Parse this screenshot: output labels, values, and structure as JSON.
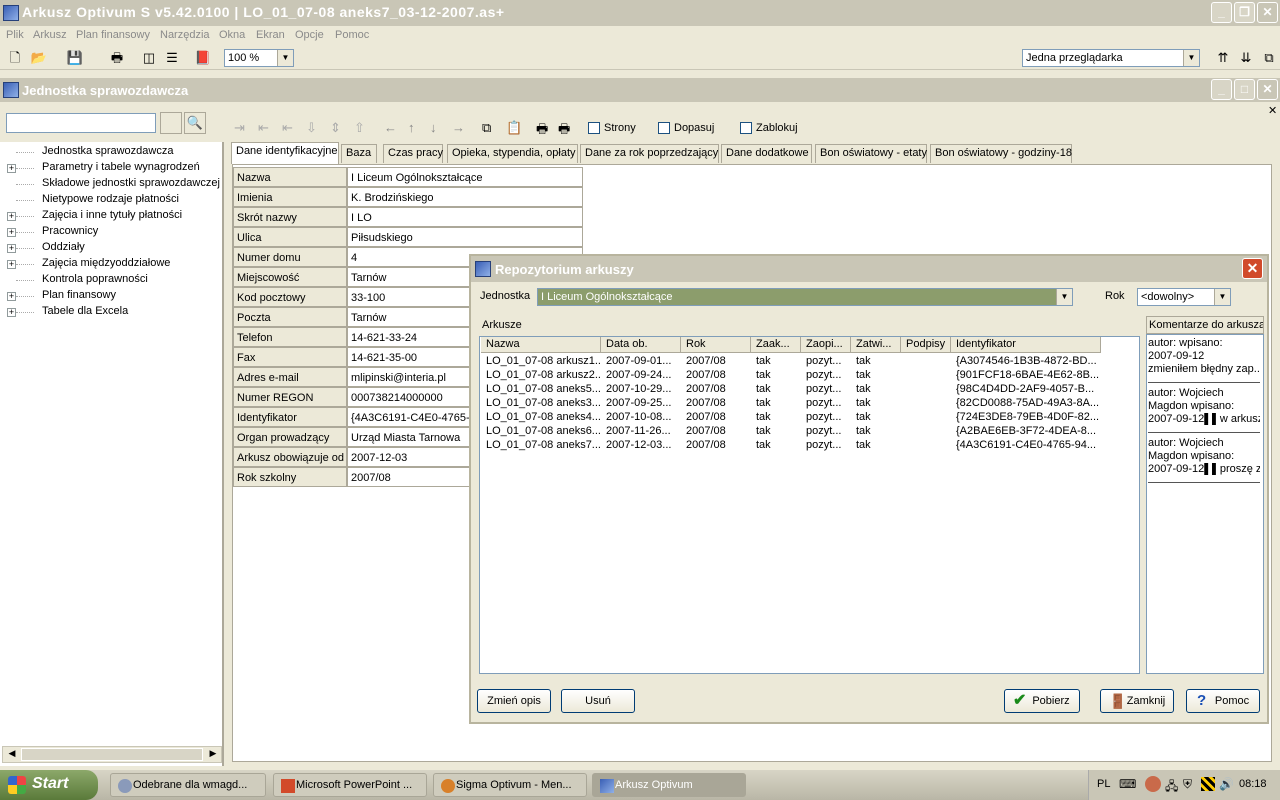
{
  "app": {
    "title": "Arkusz Optivum S v5.42.0100 | LO_01_07-08 aneks7_03-12-2007.as+"
  },
  "menu": [
    "Plik",
    "Arkusz",
    "Plan finansowy",
    "Narzędzia",
    "Okna",
    "Ekran",
    "Opcje",
    "Pomoc"
  ],
  "toolbar": {
    "zoom": "100 %",
    "viewer": "Jedna przeglądarka"
  },
  "child_window": {
    "title": "Jednostka sprawozdawcza"
  },
  "tree": [
    {
      "label": "Jednostka sprawozdawcza",
      "expandable": false
    },
    {
      "label": "Parametry i tabele wynagrodzeń",
      "expandable": true
    },
    {
      "label": "Składowe jednostki sprawozdawczej",
      "expandable": false
    },
    {
      "label": "Nietypowe rodzaje płatności",
      "expandable": false
    },
    {
      "label": "Zajęcia i inne tytuły płatności",
      "expandable": true
    },
    {
      "label": "Pracownicy",
      "expandable": true
    },
    {
      "label": "Oddziały",
      "expandable": true
    },
    {
      "label": "Zajęcia międzyoddziałowe",
      "expandable": true
    },
    {
      "label": "Kontrola poprawności",
      "expandable": false
    },
    {
      "label": "Plan finansowy",
      "expandable": true
    },
    {
      "label": "Tabele dla Excela",
      "expandable": true
    }
  ],
  "checkboxes": [
    "Strony",
    "Dopasuj",
    "Zablokuj"
  ],
  "tabs": [
    "Dane identyfikacyjne",
    "Baza",
    "Czas pracy",
    "Opieka, stypendia, opłaty",
    "Dane za rok poprzedzający",
    "Dane dodatkowe",
    "Bon oświatowy - etaty",
    "Bon oświatowy - godziny-18"
  ],
  "form": [
    {
      "label": "Nazwa",
      "value": "I Liceum Ogólnokształcące"
    },
    {
      "label": "Imienia",
      "value": "K. Brodzińskiego"
    },
    {
      "label": "Skrót nazwy",
      "value": "I LO"
    },
    {
      "label": "Ulica",
      "value": "Piłsudskiego"
    },
    {
      "label": "Numer domu",
      "value": "4"
    },
    {
      "label": "Miejscowość",
      "value": "Tarnów"
    },
    {
      "label": "Kod pocztowy",
      "value": "33-100"
    },
    {
      "label": "Poczta",
      "value": "Tarnów"
    },
    {
      "label": "Telefon",
      "value": "14-621-33-24"
    },
    {
      "label": "Fax",
      "value": "14-621-35-00"
    },
    {
      "label": "Adres e-mail",
      "value": "mlipinski@interia.pl"
    },
    {
      "label": "Numer REGON",
      "value": "000738214000000"
    },
    {
      "label": "Identyfikator",
      "value": "{4A3C6191-C4E0-4765-9"
    },
    {
      "label": "Organ prowadzący",
      "value": "Urząd Miasta Tarnowa"
    },
    {
      "label": "Arkusz obowiązuje od",
      "value": "2007-12-03"
    },
    {
      "label": "Rok szkolny",
      "value": "2007/08"
    }
  ],
  "dialog": {
    "title": "Repozytorium arkuszy",
    "jednostka_label": "Jednostka",
    "jednostka_value": "I Liceum Ogólnokształcące",
    "rok_label": "Rok",
    "rok_value": "<dowolny>",
    "list_label": "Arkusze",
    "comments_label": "Komentarze do arkusza",
    "columns": [
      "Nazwa",
      "Data ob.",
      "Rok",
      "Zaak...",
      "Zaopi...",
      "Zatwi...",
      "Podpisy",
      "Identyfikator"
    ],
    "rows": [
      [
        "LO_01_07-08 arkusz1...",
        "2007-09-01...",
        "2007/08",
        "tak",
        "pozyt...",
        "tak",
        "",
        "{A3074546-1B3B-4872-BD..."
      ],
      [
        "LO_01_07-08 arkusz2...",
        "2007-09-24...",
        "2007/08",
        "tak",
        "pozyt...",
        "tak",
        "",
        "{901FCF18-6BAE-4E62-8B..."
      ],
      [
        "LO_01_07-08 aneks5...",
        "2007-10-29...",
        "2007/08",
        "tak",
        "pozyt...",
        "tak",
        "",
        "{98C4D4DD-2AF9-4057-B..."
      ],
      [
        "LO_01_07-08 aneks3...",
        "2007-09-25...",
        "2007/08",
        "tak",
        "pozyt...",
        "tak",
        "",
        "{82CD0088-75AD-49A3-8A..."
      ],
      [
        "LO_01_07-08 aneks4...",
        "2007-10-08...",
        "2007/08",
        "tak",
        "pozyt...",
        "tak",
        "",
        "{724E3DE8-79EB-4D0F-82..."
      ],
      [
        "LO_01_07-08 aneks6...",
        "2007-11-26...",
        "2007/08",
        "tak",
        "pozyt...",
        "tak",
        "",
        "{A2BAE6EB-3F72-4DEA-8..."
      ],
      [
        "LO_01_07-08 aneks7...",
        "2007-12-03...",
        "2007/08",
        "tak",
        "pozyt...",
        "tak",
        "",
        "{4A3C6191-C4E0-4765-94..."
      ]
    ],
    "comments": [
      [
        "autor:  wpisano:",
        "2007-09-12",
        "zmieniłem błędny zap..."
      ],
      [
        "autor: Wojciech",
        "Magdon wpisano:",
        "2007-09-12▌▌w arkusz..."
      ],
      [
        "autor: Wojciech",
        "Magdon wpisano:",
        "2007-09-12▌▌proszę z..."
      ]
    ],
    "buttons": {
      "change": "Zmień opis",
      "delete": "Usuń",
      "fetch": "Pobierz",
      "close": "Zamknij",
      "help": "Pomoc"
    }
  },
  "taskbar": {
    "start": "Start",
    "tasks": [
      "Odebrane dla wmagd...",
      "Microsoft PowerPoint ...",
      "Sigma Optivum - Men...",
      "Arkusz Optivum"
    ],
    "lang": "PL",
    "clock": "08:18"
  }
}
